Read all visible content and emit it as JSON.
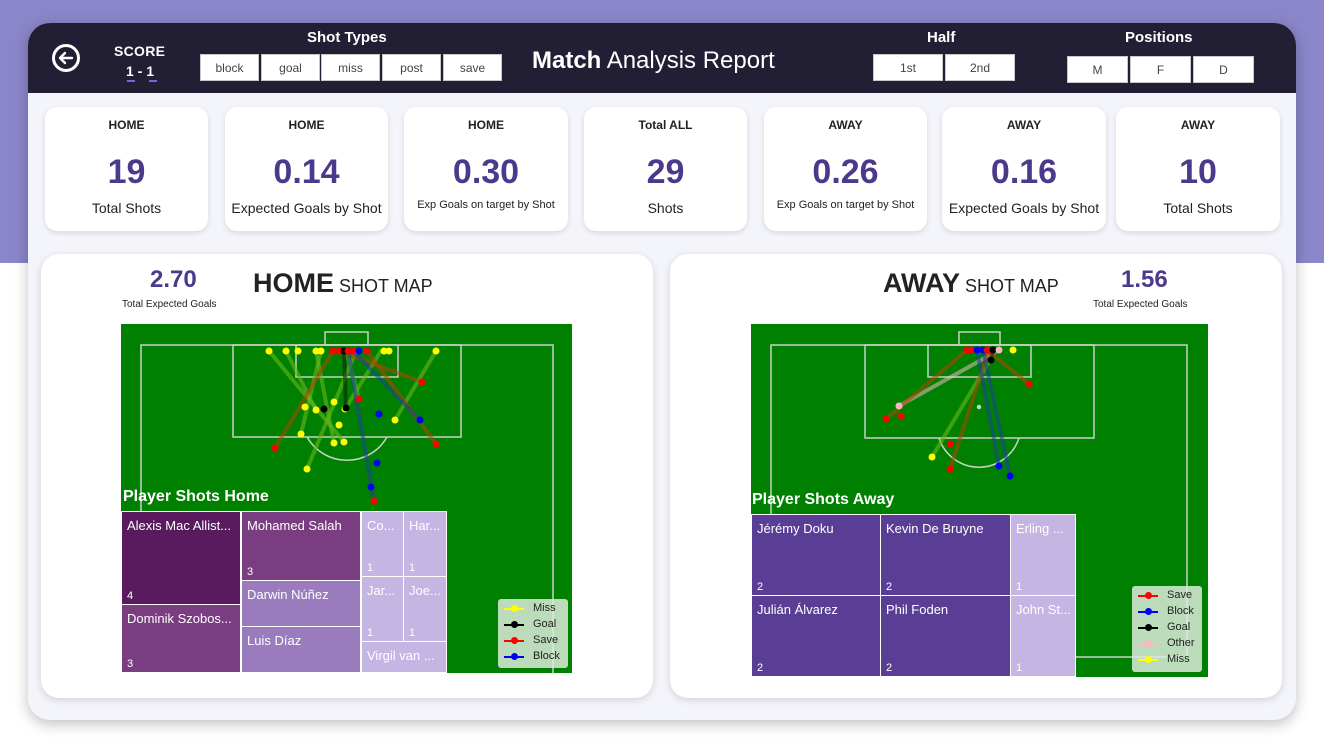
{
  "header": {
    "score_label": "SCORE",
    "score_value": "1 - 1",
    "shot_types_title": "Shot Types",
    "shot_types": [
      "block",
      "goal",
      "miss",
      "post",
      "save"
    ],
    "report_title_bold": "Match",
    "report_title_rest": " Analysis Report",
    "half_title": "Half",
    "halves": [
      "1st",
      "2nd"
    ],
    "positions_title": "Positions",
    "positions": [
      "M",
      "F",
      "D"
    ]
  },
  "kpis": [
    {
      "head": "HOME",
      "value": "19",
      "sub": "Total Shots"
    },
    {
      "head": "HOME",
      "value": "0.14",
      "sub": "Expected Goals by Shot"
    },
    {
      "head": "HOME",
      "value": "0.30",
      "sub": "Exp Goals on target by Shot"
    },
    {
      "head": "Total ALL",
      "value": "29",
      "sub": "Shots"
    },
    {
      "head": "AWAY",
      "value": "0.26",
      "sub": "Exp Goals on target by Shot"
    },
    {
      "head": "AWAY",
      "value": "0.16",
      "sub": "Expected Goals by Shot"
    },
    {
      "head": "AWAY",
      "value": "10",
      "sub": "Total Shots"
    }
  ],
  "home": {
    "total_xg": "2.70",
    "total_xg_label": "Total Expected Goals",
    "title_bold": "HOME",
    "title_rest": " SHOT MAP",
    "treemap_title": "Player Shots Home",
    "players": [
      {
        "name": "Alexis Mac Allist...",
        "shots": "4"
      },
      {
        "name": "Dominik Szobos...",
        "shots": "3"
      },
      {
        "name": "Mohamed Salah",
        "shots": "3"
      },
      {
        "name": "Darwin Núñez",
        "shots": ""
      },
      {
        "name": "Luis Díaz",
        "shots": ""
      },
      {
        "name": "Co...",
        "shots": "1"
      },
      {
        "name": "Har...",
        "shots": "1"
      },
      {
        "name": "Jar...",
        "shots": "1"
      },
      {
        "name": "Joe...",
        "shots": "1"
      },
      {
        "name": "Virgil van ...",
        "shots": ""
      }
    ],
    "legend": [
      {
        "label": "Miss",
        "color": "#ffff00"
      },
      {
        "label": "Goal",
        "color": "#000000"
      },
      {
        "label": "Save",
        "color": "#ff0000"
      },
      {
        "label": "Block",
        "color": "#0000ff"
      }
    ]
  },
  "away": {
    "total_xg": "1.56",
    "total_xg_label": "Total Expected Goals",
    "title_bold": "AWAY",
    "title_rest": " SHOT MAP",
    "treemap_title": "Player Shots Away",
    "players": [
      {
        "name": "Jérémy Doku",
        "shots": "2"
      },
      {
        "name": "Julián Álvarez",
        "shots": "2"
      },
      {
        "name": "Kevin De Bruyne",
        "shots": "2"
      },
      {
        "name": "Phil Foden",
        "shots": "2"
      },
      {
        "name": "Erling ...",
        "shots": "1"
      },
      {
        "name": "John St...",
        "shots": "1"
      }
    ],
    "legend": [
      {
        "label": "Save",
        "color": "#ff0000"
      },
      {
        "label": "Block",
        "color": "#0000ff"
      },
      {
        "label": "Goal",
        "color": "#000000"
      },
      {
        "label": "Other",
        "color": "#ffb6c1"
      },
      {
        "label": "Miss",
        "color": "#ffff00"
      }
    ]
  },
  "colors": {
    "header_bg": "#221e33",
    "accent": "#4b3a8c",
    "pitch": "#008000",
    "tile_dark": "#5a1a5e",
    "tile_mid": "#7b3d82",
    "tile_light": "#9a7bbd",
    "tile_pale": "#c4b5e3",
    "tile_away": "#5a3e96"
  }
}
